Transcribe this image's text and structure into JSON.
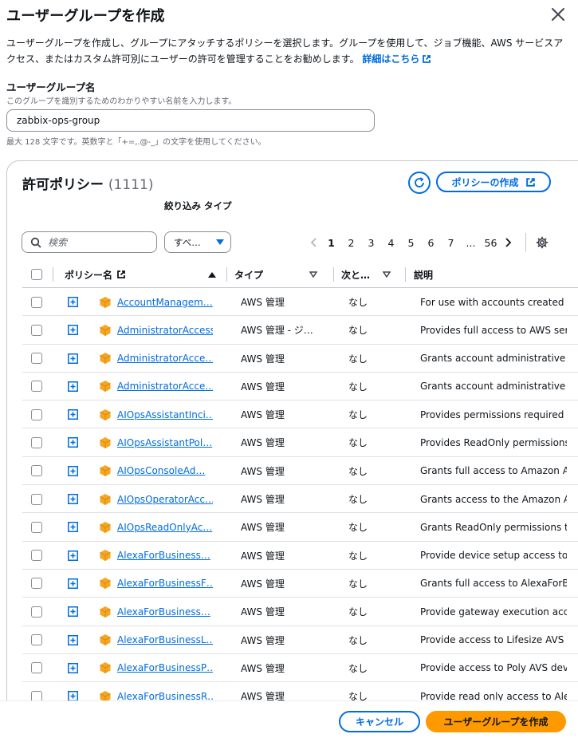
{
  "modal": {
    "title": "ユーザーグループを作成",
    "intro": "ユーザーグループを作成し、グループにアタッチするポリシーを選択します。グループを使用して、ジョブ機能、AWS サービスアクセス、またはカスタム許可別にユーザーの許可を管理することをお勧めします。",
    "learn_more": "詳細はこちら"
  },
  "group_name": {
    "label": "ユーザーグループ名",
    "description": "このグループを識別するためのわかりやすい名前を入力します。",
    "value": "zabbix-ops-group",
    "constraint": "最大 128 文字です。英数字と「+=,.@-_」の文字を使用してください。"
  },
  "policies": {
    "title": "許可ポリシー",
    "count": "(1111)",
    "create_button": "ポリシーの作成",
    "filter_type_label": "絞り込み タイプ",
    "search_placeholder": "検索",
    "type_filter_value": "すべ…",
    "pagination": {
      "pages": [
        "1",
        "2",
        "3",
        "4",
        "5",
        "6",
        "7",
        "...",
        "56"
      ],
      "current": "1"
    },
    "columns": {
      "name": "ポリシー名",
      "type": "タイプ",
      "used_as": "次と…",
      "description": "説明"
    },
    "rows": [
      {
        "name": "AccountManagem…",
        "type": "AWS 管理",
        "used_as": "なし",
        "description": "For use with accounts created thro"
      },
      {
        "name": "AdministratorAccess",
        "type": "AWS 管理 - ジ…",
        "used_as": "なし",
        "description": "Provides full access to AWS servic"
      },
      {
        "name": "AdministratorAcce…",
        "type": "AWS 管理",
        "used_as": "なし",
        "description": "Grants account administrative per"
      },
      {
        "name": "AdministratorAcce…",
        "type": "AWS 管理",
        "used_as": "なし",
        "description": "Grants account administrative per"
      },
      {
        "name": "AIOpsAssistantInci…",
        "type": "AWS 管理",
        "used_as": "なし",
        "description": "Provides permissions required by"
      },
      {
        "name": "AIOpsAssistantPol…",
        "type": "AWS 管理",
        "used_as": "なし",
        "description": "Provides ReadOnly permissions re"
      },
      {
        "name": "AIOpsConsoleAd…",
        "type": "AWS 管理",
        "used_as": "なし",
        "description": "Grants full access to Amazon AI O"
      },
      {
        "name": "AIOpsOperatorAcc…",
        "type": "AWS 管理",
        "used_as": "なし",
        "description": "Grants access to the Amazon AI O"
      },
      {
        "name": "AIOpsReadOnlyAc…",
        "type": "AWS 管理",
        "used_as": "なし",
        "description": "Grants ReadOnly permissions to t"
      },
      {
        "name": "AlexaForBusiness…",
        "type": "AWS 管理",
        "used_as": "なし",
        "description": "Provide device setup access to Ale"
      },
      {
        "name": "AlexaForBusinessF…",
        "type": "AWS 管理",
        "used_as": "なし",
        "description": "Grants full access to AlexaForBusi"
      },
      {
        "name": "AlexaForBusiness…",
        "type": "AWS 管理",
        "used_as": "なし",
        "description": "Provide gateway execution access"
      },
      {
        "name": "AlexaForBusinessL…",
        "type": "AWS 管理",
        "used_as": "なし",
        "description": "Provide access to Lifesize AVS dev"
      },
      {
        "name": "AlexaForBusinessP…",
        "type": "AWS 管理",
        "used_as": "なし",
        "description": "Provide access to Poly AVS device"
      },
      {
        "name": "AlexaForBusinessR…",
        "type": "AWS 管理",
        "used_as": "なし",
        "description": "Provide read only access to AlexaF"
      }
    ]
  },
  "footer": {
    "cancel": "キャンセル",
    "create": "ユーザーグループを作成"
  },
  "colors": {
    "accent": "#006ce0",
    "primary": "#ff9900",
    "aws_icon": "#f5a623"
  }
}
